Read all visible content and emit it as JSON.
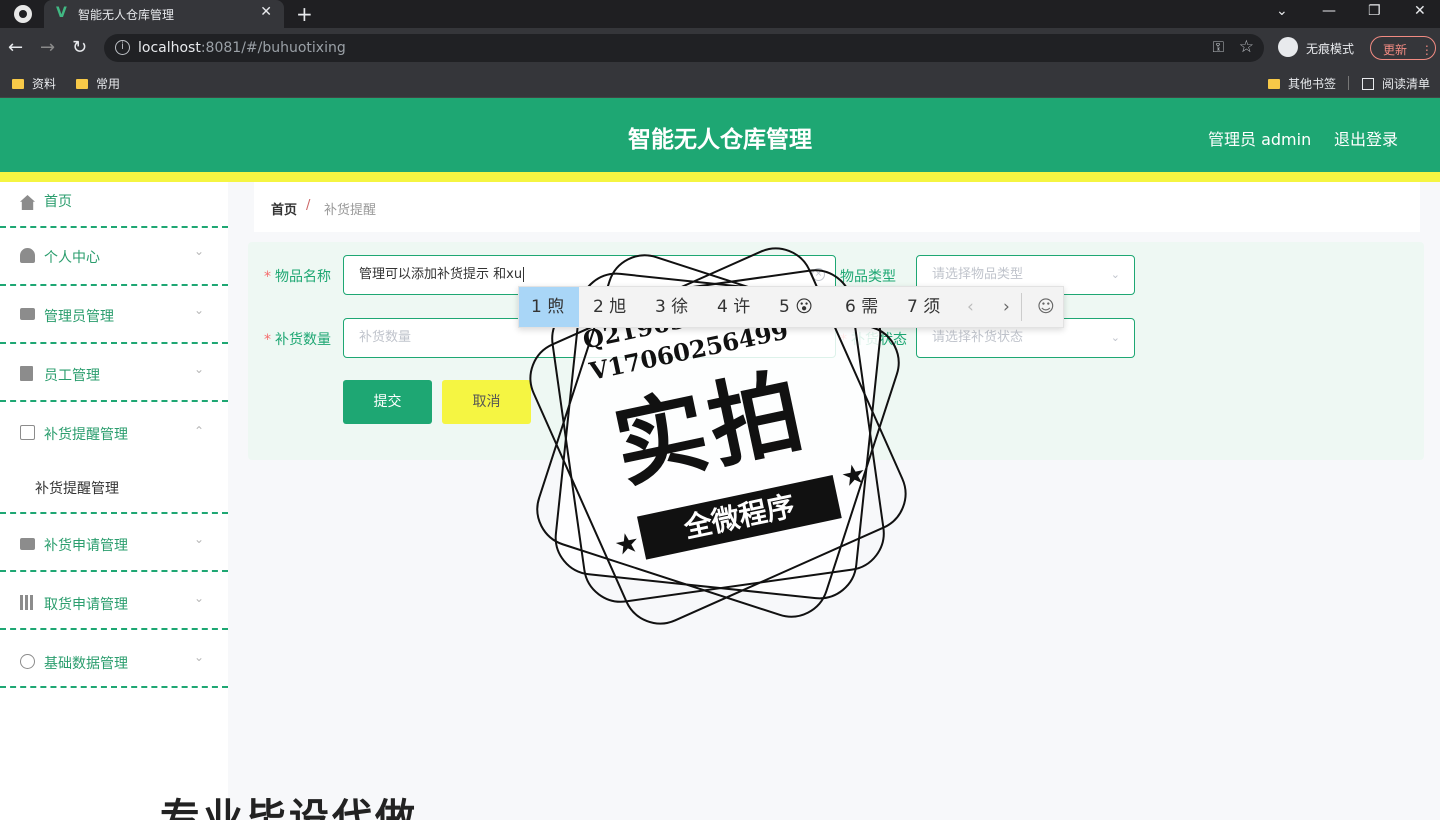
{
  "browser": {
    "tab_title": "智能无人仓库管理",
    "tab_close": "✕",
    "new_tab": "+",
    "win_controls": [
      "⌄",
      "—",
      "❐",
      "✕"
    ],
    "nav": {
      "back": "←",
      "forward": "→",
      "reload": "↻"
    },
    "url_host": "localhost",
    "url_rest": ":8081/#/buhuotixing",
    "info_icon": "i",
    "key_icon": "⚿",
    "star_icon": "☆",
    "incognito_label": "无痕模式",
    "update_label": "更新",
    "update_menu": "⋮",
    "bookmarks": [
      "资料",
      "常用"
    ],
    "other_bookmarks": "其他书签",
    "reading_list": "阅读清单"
  },
  "header": {
    "title": "智能无人仓库管理",
    "user": "管理员 admin",
    "logout": "退出登录"
  },
  "sidebar": {
    "arrow_down": "⌄",
    "arrow_up": "⌃",
    "items": [
      {
        "label": "首页",
        "icon": "home-icon"
      },
      {
        "label": "个人中心",
        "icon": "user-icon"
      },
      {
        "label": "管理员管理",
        "icon": "briefcase-icon"
      },
      {
        "label": "员工管理",
        "icon": "clipboard-icon"
      },
      {
        "label": "补货提醒管理",
        "icon": "copy-icon"
      },
      {
        "label": "补货申请管理",
        "icon": "monitor-icon"
      },
      {
        "label": "取货申请管理",
        "icon": "books-icon"
      },
      {
        "label": "基础数据管理",
        "icon": "clock-icon"
      }
    ],
    "sub_item": "补货提醒管理"
  },
  "breadcrumb": {
    "home": "首页",
    "sep": "/",
    "current": "补货提醒"
  },
  "form": {
    "required_mark": "*",
    "item_name_label": "物品名称",
    "item_name_value": "管理可以添加补货提示 和xu",
    "item_type_label": "物品类型",
    "item_type_placeholder": "请选择物品类型",
    "quantity_label": "补货数量",
    "quantity_placeholder": "补货数量",
    "status_label": "补货状态",
    "status_placeholder": "请选择补货状态",
    "clear_icon": "×",
    "chevron": "⌄",
    "submit": "提交",
    "cancel": "取消"
  },
  "ime": {
    "candidates": [
      "1 煦",
      "2 旭",
      "3 徐",
      "4 许",
      "5 😮",
      "6 需",
      "7 须"
    ],
    "prev": "‹",
    "next": "›",
    "emoji": "☺"
  },
  "watermark": {
    "qq": "Q2196316269",
    "wechat": "V17060256499",
    "big_text": "实拍",
    "banner": "全微程序",
    "star": "★",
    "bottom": "专业毕设代做"
  }
}
